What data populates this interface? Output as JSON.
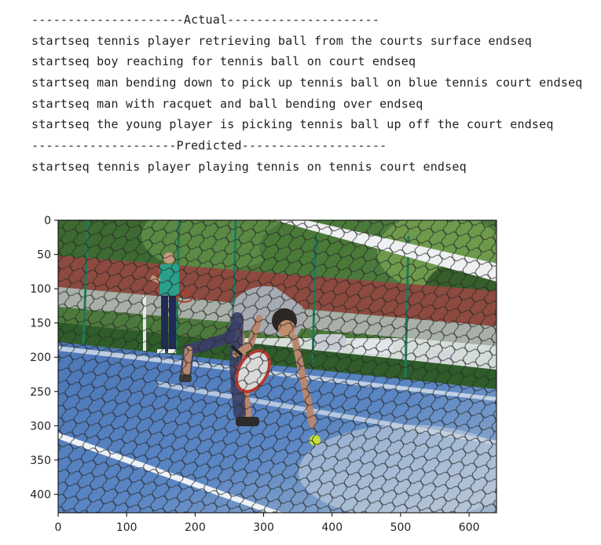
{
  "output": {
    "lines": [
      "---------------------Actual---------------------",
      "startseq tennis player retrieving ball from the courts surface endseq",
      "startseq boy reaching for tennis ball on court endseq",
      "startseq man bending down to pick up tennis ball on blue tennis court endseq",
      "startseq man with racquet and ball bending over endseq",
      "startseq the young player is picking tennis ball up off the court endseq",
      "--------------------Predicted--------------------",
      "startseq tennis player playing tennis on tennis court endseq"
    ]
  },
  "chart_data": {
    "type": "image",
    "x_ticks": [
      0,
      100,
      200,
      300,
      400,
      500,
      600
    ],
    "y_ticks": [
      0,
      50,
      100,
      150,
      200,
      250,
      300,
      350,
      400
    ],
    "xlim": [
      0,
      640
    ],
    "ylim": [
      427,
      0
    ]
  },
  "image": {
    "subject": "tennis player bending to pick up ball on blue court behind a net"
  },
  "colors": {
    "court_blue": "#4f7fc0",
    "court_light": "#9fb6cf",
    "trees": "#3f6a32",
    "fence": "#1f7a5a",
    "shirt": "#a7acb3",
    "ball": "#c6e03a",
    "roof": "#8e4a3f"
  }
}
